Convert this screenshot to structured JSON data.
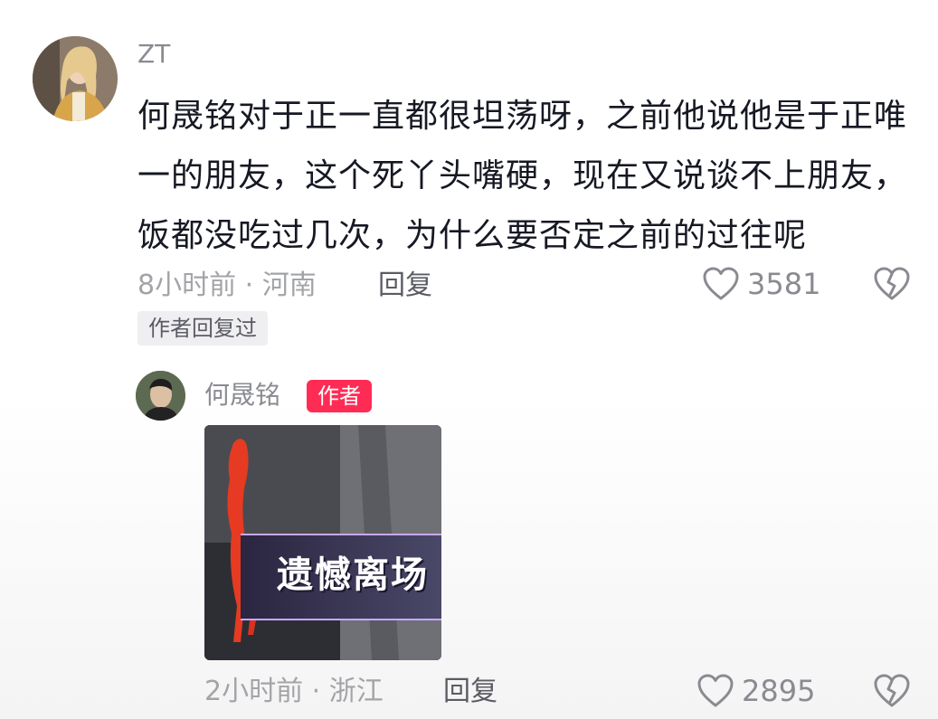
{
  "comment": {
    "username": "ZT",
    "text": "何晟铭对于正一直都很坦荡呀，之前他说他是于正唯一的朋友，这个死丫头嘴硬，现在又说谈不上朋友，饭都没吃过几次，为什么要否定之前的过往呢",
    "meta": "8小时前 · 河南",
    "reply_label": "回复",
    "like_count": "3581",
    "author_replied_tag": "作者回复过"
  },
  "reply": {
    "username": "何晟铭",
    "author_badge": "作者",
    "image_caption": "遗憾离场",
    "meta": "2小时前 · 浙江",
    "reply_label": "回复",
    "like_count": "2895"
  },
  "colors": {
    "text": "#161823",
    "muted": "#8a8b91",
    "badge": "#fe2c55",
    "tag_bg": "#efeff1"
  },
  "icons": {
    "like": "heart-outline-icon",
    "dislike": "broken-heart-icon"
  }
}
